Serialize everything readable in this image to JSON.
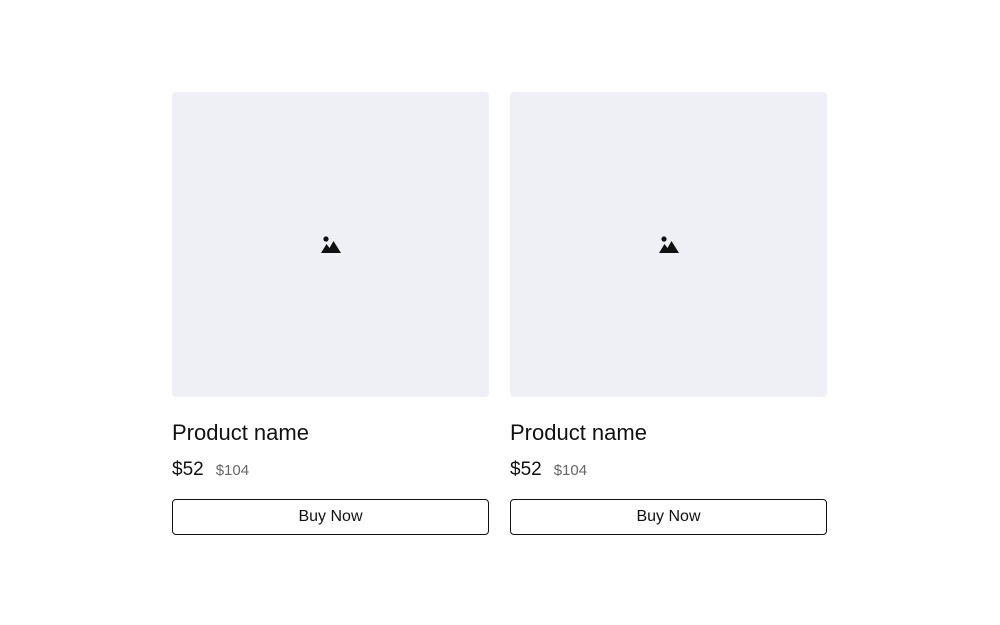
{
  "products": [
    {
      "image_icon": "image-placeholder-icon",
      "name": "Product name",
      "price": "$52",
      "compare_price": "$104",
      "button_label": "Buy Now"
    },
    {
      "image_icon": "image-placeholder-icon",
      "name": "Product name",
      "price": "$52",
      "compare_price": "$104",
      "button_label": "Buy Now"
    }
  ],
  "colors": {
    "image_background": "#eff0f5",
    "text": "#111111",
    "muted_text": "#666666",
    "button_border": "#111111"
  }
}
